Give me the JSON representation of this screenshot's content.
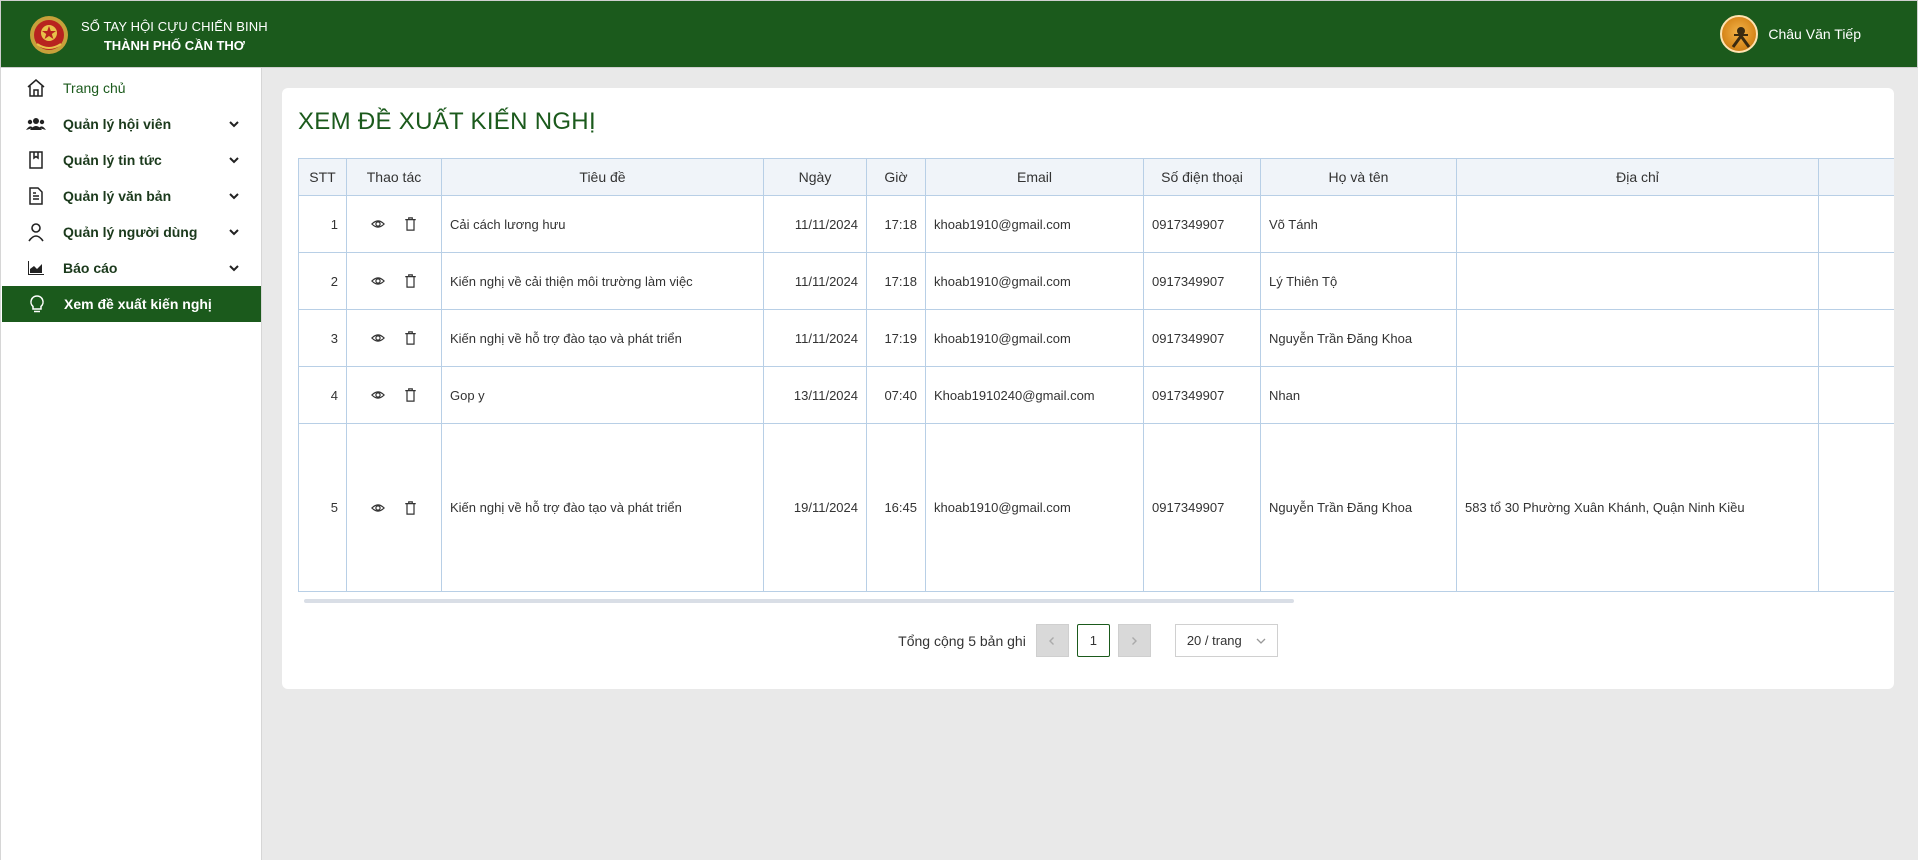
{
  "header": {
    "org_line1": "SỔ TAY HỘI CỰU CHIẾN BINH",
    "org_line2": "THÀNH PHỐ CẦN THƠ",
    "user_name": "Châu Văn Tiếp"
  },
  "sidebar": {
    "items": [
      {
        "label": "Trang chủ",
        "icon": "home-icon"
      },
      {
        "label": "Quản lý hội viên",
        "icon": "users-icon"
      },
      {
        "label": "Quản lý tin tức",
        "icon": "book-icon"
      },
      {
        "label": "Quản lý văn bản",
        "icon": "document-icon"
      },
      {
        "label": "Quản lý người dùng",
        "icon": "user-icon"
      },
      {
        "label": "Báo cáo",
        "icon": "chart-icon"
      },
      {
        "label": "Xem đề xuất kiến nghị",
        "icon": "lightbulb-icon"
      }
    ]
  },
  "page": {
    "title": "XEM ĐỀ XUẤT KIẾN NGHỊ"
  },
  "table": {
    "columns": [
      "STT",
      "Thao tác",
      "Tiêu đề",
      "Ngày",
      "Giờ",
      "Email",
      "Số điện thoại",
      "Họ và tên",
      "Địa chỉ"
    ],
    "rows": [
      {
        "stt": "1",
        "title": "Cải cách lương hưu",
        "date": "11/11/2024",
        "time": "17:18",
        "email": "khoab1910@gmail.com",
        "phone": "0917349907",
        "name": "Võ Tánh",
        "address": ""
      },
      {
        "stt": "2",
        "title": "Kiến nghị về cải thiện môi trường làm việc",
        "date": "11/11/2024",
        "time": "17:18",
        "email": "khoab1910@gmail.com",
        "phone": "0917349907",
        "name": "Lý Thiên Tộ",
        "address": ""
      },
      {
        "stt": "3",
        "title": "Kiến nghị về hỗ trợ đào tạo và phát triển",
        "date": "11/11/2024",
        "time": "17:19",
        "email": "khoab1910@gmail.com",
        "phone": "0917349907",
        "name": "Nguyễn Trần Đăng Khoa",
        "address": ""
      },
      {
        "stt": "4",
        "title": "Gop y",
        "date": "13/11/2024",
        "time": "07:40",
        "email": "Khoab1910240@gmail.com",
        "phone": "0917349907",
        "name": "Nhan",
        "address": ""
      },
      {
        "stt": "5",
        "title": "Kiến nghị về hỗ trợ đào tạo và phát triển",
        "date": "19/11/2024",
        "time": "16:45",
        "email": "khoab1910@gmail.com",
        "phone": "0917349907",
        "name": "Nguyễn Trần Đăng Khoa",
        "address": "583 tổ 30 Phường Xuân Khánh, Quận Ninh Kiều"
      }
    ]
  },
  "pagination": {
    "total_text": "Tổng cộng 5 bản ghi",
    "current_page": "1",
    "page_size": "20 / trang"
  },
  "colors": {
    "brand_green": "#1b5a1c",
    "table_border": "#b8cfe6"
  }
}
